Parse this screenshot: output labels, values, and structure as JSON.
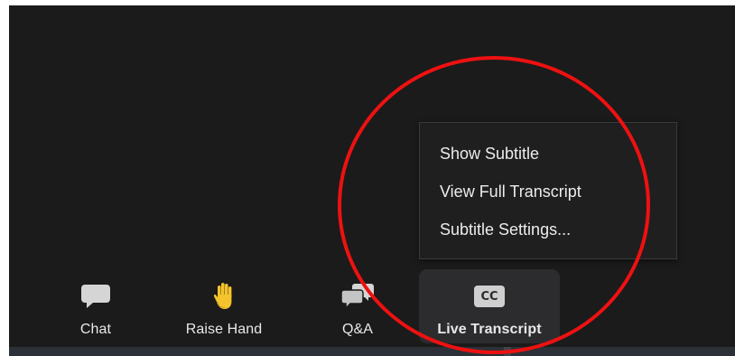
{
  "toolbar": {
    "items": [
      {
        "id": "chat",
        "label": "Chat",
        "icon": "chat-bubble-icon"
      },
      {
        "id": "raise-hand",
        "label": "Raise Hand",
        "icon": "raised-hand-icon"
      },
      {
        "id": "qa",
        "label": "Q&A",
        "icon": "qa-bubbles-icon"
      },
      {
        "id": "live-transcript",
        "label": "Live Transcript",
        "icon": "cc-icon",
        "icon_text": "CC",
        "active": true
      }
    ]
  },
  "transcript_menu": {
    "items": [
      {
        "label": "Show Subtitle"
      },
      {
        "label": "View Full Transcript"
      },
      {
        "label": "Subtitle Settings..."
      }
    ]
  },
  "colors": {
    "background": "#1b1b1b",
    "menu_background": "#1f1f1f",
    "text": "#e8e8e8",
    "icon_gray": "#d5d5d5",
    "hand_yellow": "#f5c32c",
    "annotation_red": "#ee1111"
  }
}
